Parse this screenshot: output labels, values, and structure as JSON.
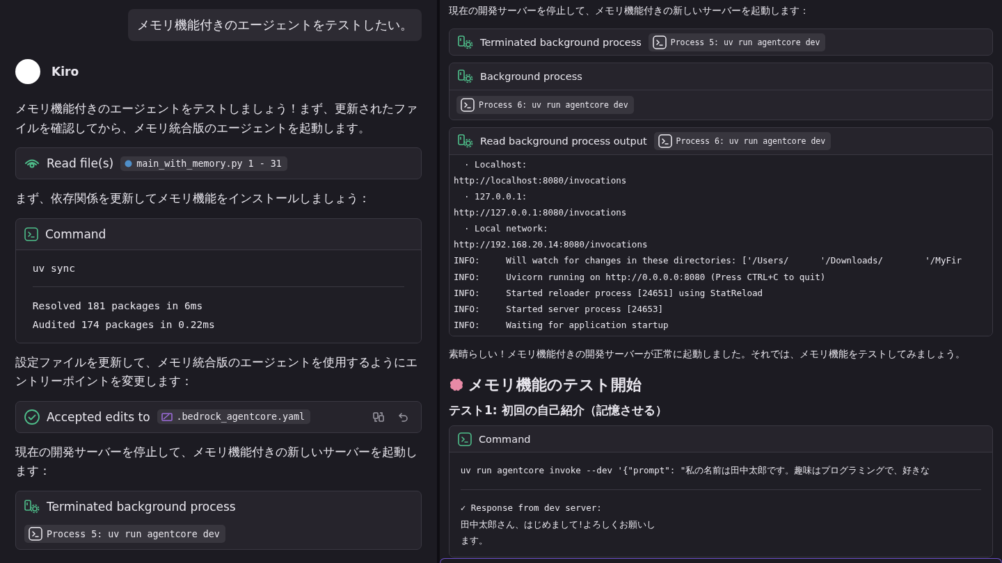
{
  "left_pane": {
    "items": [
      {
        "kind": "user_message",
        "text": "メモリ機能付きのエージェントをテストしたい。"
      },
      {
        "kind": "agent",
        "name": "Kiro"
      },
      {
        "kind": "paragraph",
        "text": "メモリ機能付きのエージェントをテストしましょう！まず、更新されたファイルを確認してから、メモリ統合版のエージェントを起動します。"
      },
      {
        "kind": "read",
        "title": "Read file(s)",
        "chips": [
          {
            "kind": "python",
            "text": "main_with_memory.py 1 - 31"
          }
        ]
      },
      {
        "kind": "paragraph",
        "text": "まず、依存関係を更新してメモリ機能をインストールしましょう："
      },
      {
        "kind": "command",
        "title": "Command",
        "command": "uv sync",
        "output": [
          "Resolved 181 packages in 6ms",
          "Audited 174 packages in 0.22ms"
        ]
      },
      {
        "kind": "paragraph",
        "text": "設定ファイルを更新して、メモリ統合版のエージェントを使用するようにエントリーポイントを変更します："
      },
      {
        "kind": "accepted",
        "title": "Accepted edits to",
        "chips": [
          {
            "kind": "yaml",
            "text": ".bedrock_agentcore.yaml"
          }
        ]
      },
      {
        "kind": "paragraph",
        "text": "現在の開発サーバーを停止して、メモリ機能付きの新しいサーバーを起動します："
      },
      {
        "kind": "process",
        "title": "Terminated background process",
        "body_chips": [
          {
            "kind": "terminal",
            "text": "Process 5: uv run agentcore dev"
          }
        ]
      }
    ]
  },
  "right_pane": {
    "items": [
      {
        "kind": "paragraph",
        "text": "現在の開発サーバーを停止して、メモリ機能付きの新しいサーバーを起動します："
      },
      {
        "kind": "process",
        "title": "Terminated background process",
        "chips": [
          {
            "kind": "terminal",
            "text": "Process 5: uv run agentcore dev"
          }
        ]
      },
      {
        "kind": "process",
        "title": "Background process",
        "body_chips": [
          {
            "kind": "terminal",
            "text": "Process 6: uv run agentcore dev"
          }
        ]
      },
      {
        "kind": "process",
        "title": "Read background process output",
        "chips": [
          {
            "kind": "terminal",
            "text": "Process 6: uv run agentcore dev"
          }
        ],
        "log": [
          "  · Localhost:",
          "http://localhost:8080/invocations",
          "  · 127.0.0.1:",
          "http://127.0.0.1:8080/invocations",
          "  · Local network:",
          "http://192.168.20.14:8080/invocations",
          "INFO:     Will watch for changes in these directories: ['/Users/      '/Downloads/        '/MyFir",
          "INFO:     Uvicorn running on http://0.0.0.0:8080 (Press CTRL+C to quit)",
          "INFO:     Started reloader process [24651] using StatReload",
          "INFO:     Started server process [24653]",
          "INFO:     Waiting for application startup"
        ]
      },
      {
        "kind": "paragraph",
        "text": "素晴らしい！メモリ機能付きの開発サーバーが正常に起動しました。それでは、メモリ機能をテストしてみましょう。"
      },
      {
        "kind": "heading",
        "text": "メモリ機能のテスト開始"
      },
      {
        "kind": "subheading",
        "text": "テスト1: 初回の自己紹介（記憶させる）"
      },
      {
        "kind": "command",
        "title": "Command",
        "command": "uv run agentcore invoke --dev '{\"prompt\": \"私の名前は田中太郎です。趣味はプログラミングで、好きな",
        "output": [
          "✓ Response from dev server:",
          "田中太郎さん、はじめまして!よろしくお願いし",
          "ます。"
        ]
      }
    ]
  }
}
